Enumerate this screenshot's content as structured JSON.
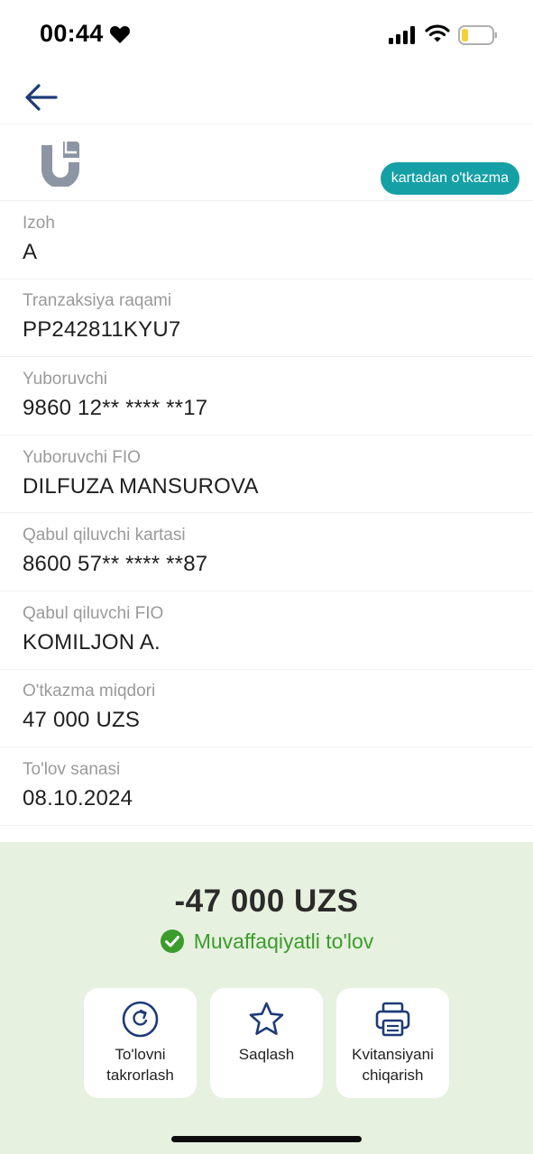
{
  "status_bar": {
    "time": "00:44",
    "icons": [
      "heart-icon",
      "signal-icon",
      "wifi-icon",
      "battery-icon"
    ],
    "battery_level": 0.2
  },
  "header": {
    "back_icon": "arrow-left-icon"
  },
  "transfer": {
    "logo_icon": "uzcard-logo-icon",
    "type_label": "kartadan o'tkazma"
  },
  "details": [
    {
      "label": "Izoh",
      "value": "A"
    },
    {
      "label": "Tranzaksiya raqami",
      "value": "PP242811KYU7"
    },
    {
      "label": "Yuboruvchi",
      "value": "9860 12** **** **17"
    },
    {
      "label": "Yuboruvchi FIO",
      "value": "DILFUZA MANSUROVA"
    },
    {
      "label": "Qabul qiluvchi kartasi",
      "value": "8600 57** **** **87"
    },
    {
      "label": "Qabul qiluvchi FIO",
      "value": "KOMILJON A."
    },
    {
      "label": "O'tkazma miqdori",
      "value": "47 000 UZS"
    },
    {
      "label": "To'lov sanasi",
      "value": "08.10.2024"
    }
  ],
  "summary": {
    "amount": "-47 000 UZS",
    "status_text": "Muvaffaqiyatli to'lov",
    "status_icon": "check-circle-icon"
  },
  "actions": [
    {
      "label": "To'lovni takrorlash",
      "icon": "repeat-icon"
    },
    {
      "label": "Saqlash",
      "icon": "star-icon"
    },
    {
      "label": "Kvitansiyani chiqarish",
      "icon": "printer-icon"
    }
  ],
  "colors": {
    "accent_navy": "#1e3a78",
    "badge_teal": "#15a0a6",
    "success_green": "#3b9c2c",
    "panel_bg": "#e7f1df",
    "label_gray": "#9a9a9a"
  }
}
